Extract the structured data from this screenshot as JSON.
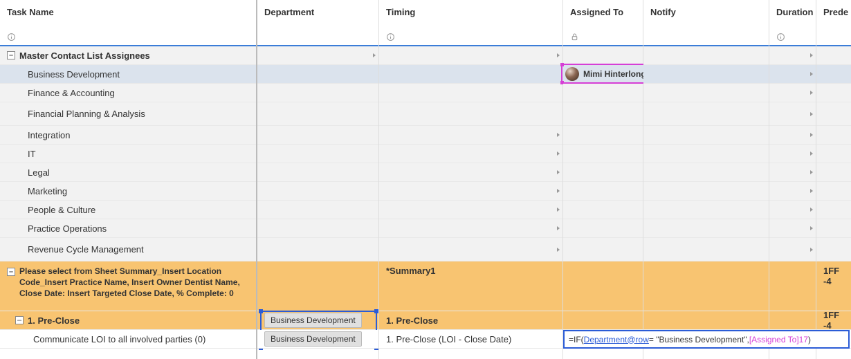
{
  "columns": {
    "taskname": "Task Name",
    "department": "Department",
    "timing": "Timing",
    "assigned": "Assigned To",
    "notify": "Notify",
    "duration": "Duration",
    "predec": "Prede"
  },
  "rows": {
    "master_header": "Master Contact List Assignees",
    "biz_dev": "Business Development",
    "finance": "Finance & Accounting",
    "fpa": "Financial Planning & Analysis",
    "integration": "Integration",
    "it": "IT",
    "legal": "Legal",
    "marketing": "Marketing",
    "people": "People & Culture",
    "practice_ops": "Practice Operations",
    "revenue": "Revenue Cycle Management",
    "summary_row": "Please select from Sheet Summary_Insert Location Code_Insert Practice Name, Insert Owner Dentist Name, Close Date: Insert Targeted Close Date, % Complete: 0",
    "summary_timing": "*Summary1",
    "summary_predec": "1FF -4",
    "preclose": "1. Pre-Close",
    "preclose_timing": "1. Pre-Close",
    "preclose_predec": "1FF -4",
    "loi": "Communicate LOI to all involved parties (0)",
    "loi_timing": "1. Pre-Close (LOI - Close Date)"
  },
  "contact": {
    "name": "Mimi Hinterlong"
  },
  "dept_chip": {
    "preclose": "Business Development",
    "loi": "Business Development"
  },
  "formula": {
    "prefix": "=IF(",
    "ref1": "Department@row",
    "mid": " = \"Business Development\", ",
    "ref2": "[Assigned To]17",
    "suffix": ")"
  },
  "toggle_minus": "–"
}
